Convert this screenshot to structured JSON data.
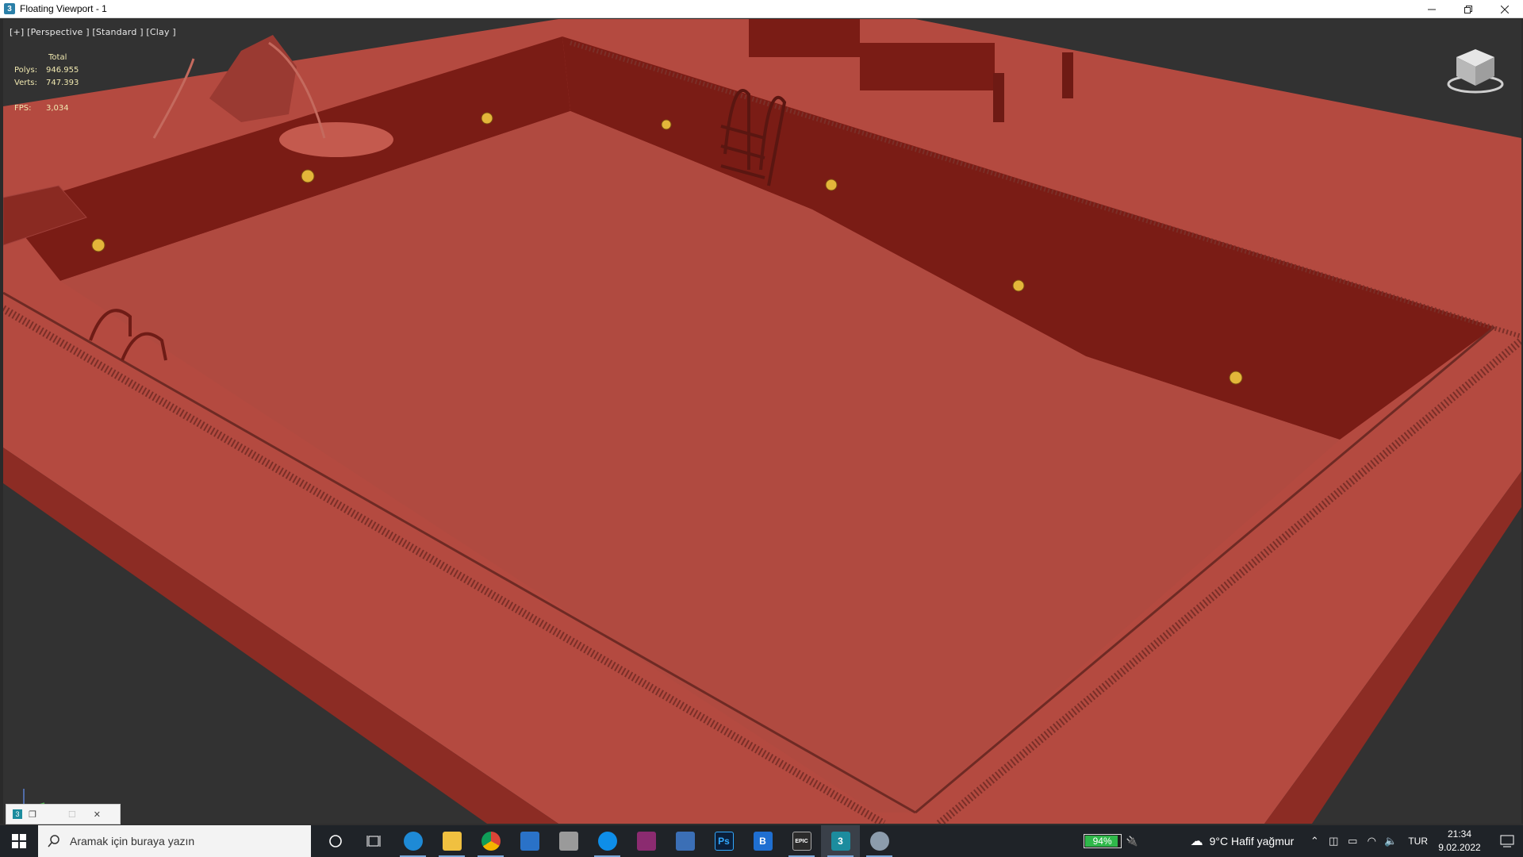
{
  "window": {
    "title": "Floating Viewport - 1",
    "icon": "3ds-max-icon",
    "controls": [
      "minimize-icon",
      "restore-icon",
      "close-icon"
    ]
  },
  "viewport": {
    "label": "[+] [Perspective ] [Standard ] [Clay ]",
    "stats": {
      "total_label": "Total",
      "polys_label": "Polys:",
      "polys_value": "946.955",
      "verts_label": "Verts:",
      "verts_value": "747.393",
      "fps_label": "FPS:",
      "fps_value": "3,034"
    },
    "scene_colors": {
      "background": "#323232",
      "deck": "#b44a40",
      "wall": "#7a1c15",
      "light": "#e3b63a"
    }
  },
  "taskbar": {
    "search_placeholder": "Aramak için buraya yazın",
    "apps": [
      {
        "name": "cortana-icon",
        "label": "",
        "color": "transparent"
      },
      {
        "name": "task-view-icon",
        "label": "",
        "color": "transparent"
      },
      {
        "name": "edge-icon",
        "label": "",
        "color": "#1e8ad6"
      },
      {
        "name": "file-explorer-icon",
        "label": "",
        "color": "#f0c040"
      },
      {
        "name": "chrome-icon",
        "label": "",
        "color": "#db4437"
      },
      {
        "name": "store-icon",
        "label": "",
        "color": "#2a72c8"
      },
      {
        "name": "generic-app-icon",
        "label": "",
        "color": "#9a9a9a"
      },
      {
        "name": "teamviewer-icon",
        "label": "",
        "color": "#0e8ee9"
      },
      {
        "name": "winrar-icon",
        "label": "",
        "color": "#8b2b70"
      },
      {
        "name": "camera-icon",
        "label": "",
        "color": "#3b6fb6"
      },
      {
        "name": "photoshop-icon",
        "label": "Ps",
        "color": "#0b1f3a"
      },
      {
        "name": "blue-b-icon",
        "label": "B",
        "color": "#1f6fd1"
      },
      {
        "name": "epic-games-icon",
        "label": "EPIC",
        "color": "#2b2b2b"
      },
      {
        "name": "3ds-max-taskbar-icon",
        "label": "3",
        "color": "#1c8c9e"
      },
      {
        "name": "misc-app-icon",
        "label": "",
        "color": "#8c9cac"
      }
    ],
    "battery_percent": "94%",
    "battery_level": 0.94,
    "weather": "9°C  Hafif yağmur",
    "language": "TUR",
    "time": "21:34",
    "date": "9.02.2022"
  }
}
